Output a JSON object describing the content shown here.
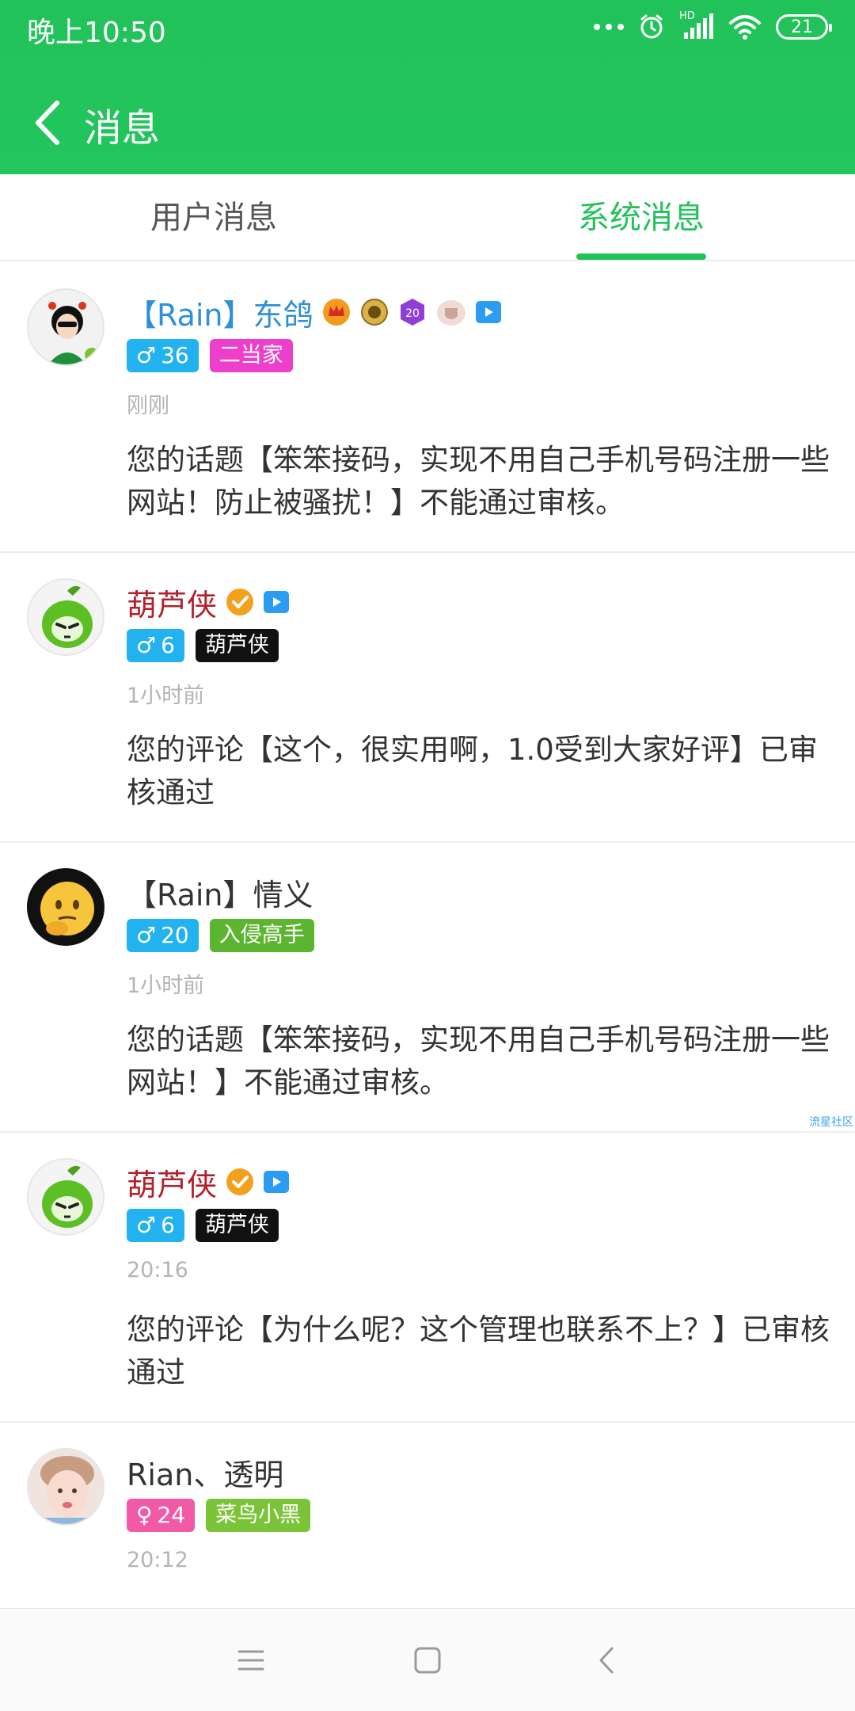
{
  "status_bar": {
    "time": "晚上10:50",
    "network_label": "HD",
    "battery": "21"
  },
  "header": {
    "title": "消息"
  },
  "tabs": [
    {
      "label": "用户消息",
      "active": false
    },
    {
      "label": "系统消息",
      "active": true
    }
  ],
  "colors": {
    "brand_green": "#22c25b",
    "male": "#22b2f0",
    "female": "#f25aa8",
    "rank_pink": "#ee3fcb",
    "rank_black": "#111111",
    "rank_green": "#5cb531",
    "rank_lightgreen": "#7cc33a"
  },
  "messages": [
    {
      "name": "【Rain】东鸽",
      "name_color": "#2f8fd8",
      "badges": [
        "crown-medal-icon",
        "gold-medal-icon",
        "level-20-badge-icon",
        "shield-badge-icon",
        "video-icon"
      ],
      "gender": "♂",
      "level": "36",
      "rank": "二当家",
      "rank_color": "#ee3fcb",
      "time": "刚刚",
      "content": "您的话题【笨笨接码，实现不用自己手机号码注册一些网站！防止被骚扰！】不能通过审核。",
      "avatar": "anime-girl-avatar"
    },
    {
      "name": "葫芦侠",
      "name_color": "#b3202c",
      "badges": [
        "verified-icon",
        "video-icon"
      ],
      "gender": "♂",
      "level": "6",
      "rank": "葫芦侠",
      "rank_color": "#111111",
      "time": "1小时前",
      "content": "您的评论【这个，很实用啊，1.0受到大家好评】已审核通过",
      "avatar": "green-gourd-avatar"
    },
    {
      "name": "【Rain】情义",
      "name_color": "#333333",
      "badges": [],
      "gender": "♂",
      "level": "20",
      "rank": "入侵高手",
      "rank_color": "#5cb531",
      "time": "1小时前",
      "content": "您的话题【笨笨接码，实现不用自己手机号码注册一些网站！】不能通过审核。",
      "avatar": "emoji-thinking-avatar"
    },
    {
      "name": "葫芦侠",
      "name_color": "#b3202c",
      "badges": [
        "verified-icon",
        "video-icon"
      ],
      "gender": "♂",
      "level": "6",
      "rank": "葫芦侠",
      "rank_color": "#111111",
      "time": "20:16",
      "content": "您的评论【为什么呢？这个管理也联系不上？】已审核通过",
      "avatar": "green-gourd-avatar"
    },
    {
      "name": "Rian、透明",
      "name_color": "#333333",
      "badges": [],
      "gender": "♀",
      "level": "24",
      "rank": "菜鸟小黑",
      "rank_color": "#7cc33a",
      "time": "20:12",
      "content": "",
      "avatar": "child-photo-avatar"
    }
  ],
  "watermark": "流星社区"
}
